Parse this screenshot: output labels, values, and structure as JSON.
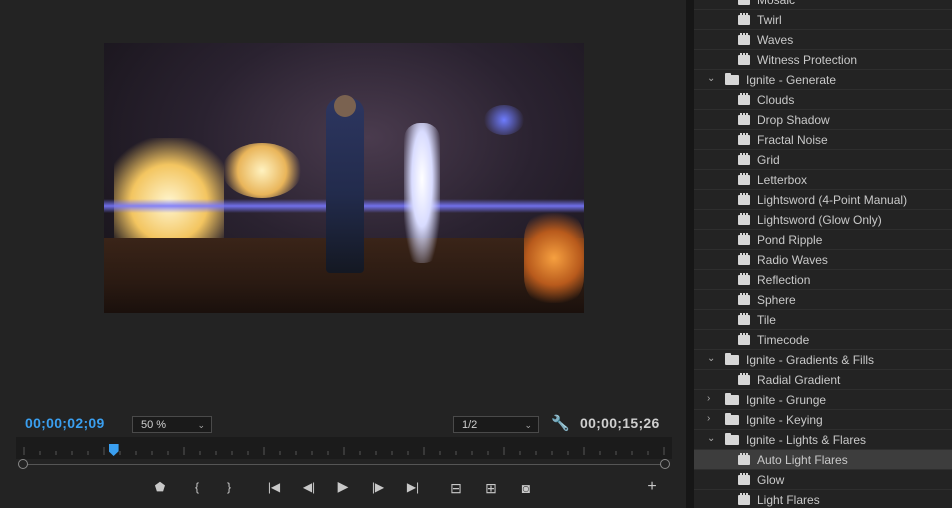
{
  "monitor": {
    "timecode_current": "00;00;02;09",
    "timecode_duration": "00;00;15;26",
    "zoom": "50 %",
    "resolution": "1/2",
    "playhead_fraction": 0.14
  },
  "transport": {
    "marker": "⬟",
    "mark_in": "{",
    "mark_out": "}",
    "go_to_in": "|◀",
    "step_back": "◀|",
    "play": "▶",
    "step_forward": "|▶",
    "go_to_out": "▶|",
    "lift": "⊟",
    "extract": "⊞",
    "export_frame": "◙",
    "add": "+"
  },
  "effects": {
    "items": [
      {
        "type": "effect",
        "label": "Mosaic"
      },
      {
        "type": "effect",
        "label": "Twirl"
      },
      {
        "type": "effect",
        "label": "Waves"
      },
      {
        "type": "effect",
        "label": "Witness Protection"
      },
      {
        "type": "bin",
        "label": "Ignite - Generate",
        "expanded": true
      },
      {
        "type": "effect",
        "label": "Clouds"
      },
      {
        "type": "effect",
        "label": "Drop Shadow"
      },
      {
        "type": "effect",
        "label": "Fractal Noise"
      },
      {
        "type": "effect",
        "label": "Grid"
      },
      {
        "type": "effect",
        "label": "Letterbox"
      },
      {
        "type": "effect",
        "label": "Lightsword (4-Point Manual)"
      },
      {
        "type": "effect",
        "label": "Lightsword (Glow Only)"
      },
      {
        "type": "effect",
        "label": "Pond Ripple"
      },
      {
        "type": "effect",
        "label": "Radio Waves"
      },
      {
        "type": "effect",
        "label": "Reflection"
      },
      {
        "type": "effect",
        "label": "Sphere"
      },
      {
        "type": "effect",
        "label": "Tile"
      },
      {
        "type": "effect",
        "label": "Timecode"
      },
      {
        "type": "bin",
        "label": "Ignite - Gradients & Fills",
        "expanded": true
      },
      {
        "type": "effect",
        "label": "Radial Gradient"
      },
      {
        "type": "bin",
        "label": "Ignite - Grunge",
        "expanded": false
      },
      {
        "type": "bin",
        "label": "Ignite - Keying",
        "expanded": false
      },
      {
        "type": "bin",
        "label": "Ignite - Lights & Flares",
        "expanded": true
      },
      {
        "type": "effect",
        "label": "Auto Light Flares",
        "selected": true
      },
      {
        "type": "effect",
        "label": "Glow"
      },
      {
        "type": "effect",
        "label": "Light Flares"
      }
    ]
  },
  "colors": {
    "accent": "#3a9ff0",
    "panel_bg": "#232323",
    "selected_row": "#3d3d3d"
  }
}
